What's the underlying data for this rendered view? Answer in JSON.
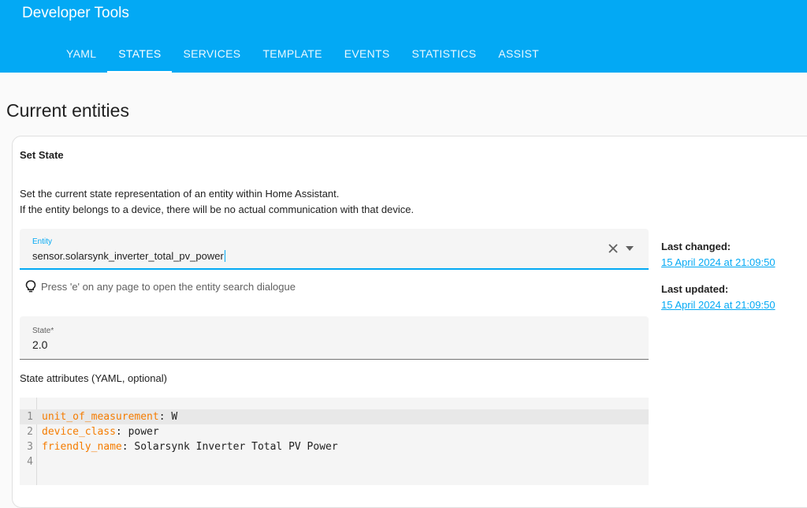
{
  "header": {
    "title": "Developer Tools",
    "tabs": [
      {
        "label": "YAML"
      },
      {
        "label": "STATES",
        "active": true
      },
      {
        "label": "SERVICES"
      },
      {
        "label": "TEMPLATE"
      },
      {
        "label": "EVENTS"
      },
      {
        "label": "STATISTICS"
      },
      {
        "label": "ASSIST"
      }
    ],
    "accent_color": "#03a9f4"
  },
  "page": {
    "title": "Current entities"
  },
  "set_state": {
    "title": "Set State",
    "description_line1": "Set the current state representation of an entity within Home Assistant.",
    "description_line2": "If the entity belongs to a device, there will be no actual communication with that device.",
    "entity": {
      "label": "Entity",
      "value": "sensor.solarsynk_inverter_total_pv_power",
      "clear_icon": "close-icon",
      "dropdown_icon": "chevron-down-icon"
    },
    "hint": {
      "icon": "lightbulb-icon",
      "text": "Press 'e' on any page to open the entity search dialogue"
    },
    "state": {
      "label": "State*",
      "value": "2.0"
    },
    "attributes_label": "State attributes (YAML, optional)",
    "code_lines": [
      {
        "num": "1",
        "key": "unit_of_measurement",
        "sep": ": ",
        "value": "W"
      },
      {
        "num": "2",
        "key": "device_class",
        "sep": ": ",
        "value": "power"
      },
      {
        "num": "3",
        "key": "friendly_name",
        "sep": ": ",
        "value": "Solarsynk Inverter Total PV Power"
      },
      {
        "num": "4",
        "key": "",
        "sep": "",
        "value": ""
      }
    ]
  },
  "meta": {
    "last_changed_label": "Last changed:",
    "last_changed_value": "15 April 2024 at 21:09:50",
    "last_updated_label": "Last updated:",
    "last_updated_value": "15 April 2024 at 21:09:50"
  }
}
